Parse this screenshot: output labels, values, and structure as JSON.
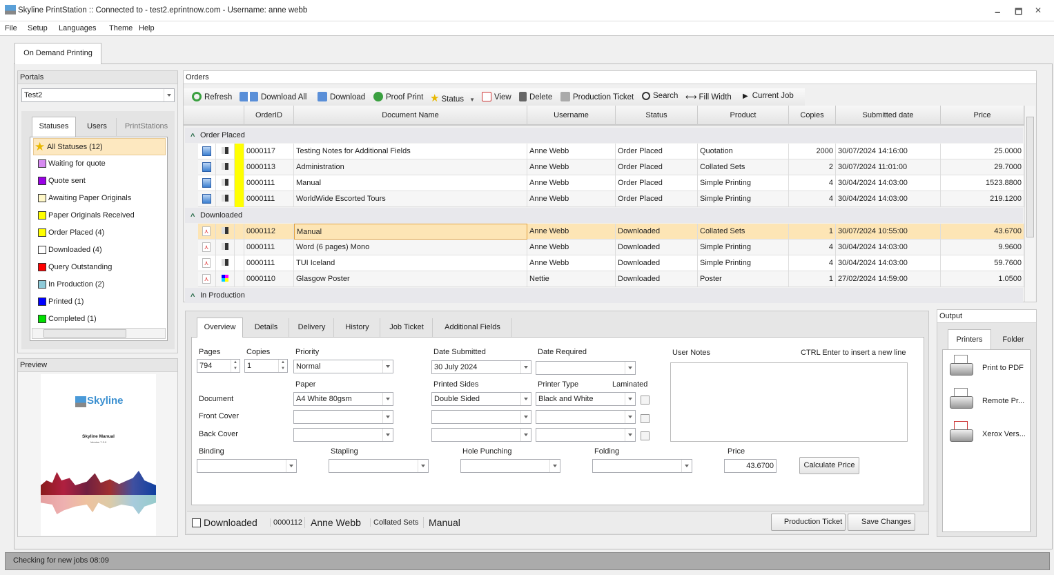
{
  "window": {
    "title": "Skyline PrintStation :: Connected to - test2.eprintnow.com - Username: anne webb",
    "minimize": "🗕",
    "maximize": "🗖",
    "close": "✕"
  },
  "menu": [
    "File",
    "Setup",
    "Languages",
    "Theme",
    "Help"
  ],
  "main_tab": "On Demand Printing",
  "portals": {
    "header": "Portals",
    "selected": "Test2",
    "tabs": [
      "Statuses",
      "Users",
      "PrintStations"
    ],
    "statuses": [
      {
        "label": "All Statuses (12)",
        "color": "star"
      },
      {
        "label": "Waiting for quote",
        "color": "#d68af0"
      },
      {
        "label": "Quote sent",
        "color": "#9a00e6"
      },
      {
        "label": "Awaiting Paper Originals",
        "color": "#fff8c8"
      },
      {
        "label": "Paper Originals Received",
        "color": "#ffff00"
      },
      {
        "label": "Order Placed (4)",
        "color": "#ffff00"
      },
      {
        "label": "Downloaded (4)",
        "color": "#ffffff"
      },
      {
        "label": "Query Outstanding",
        "color": "#ff0000"
      },
      {
        "label": "In Production (2)",
        "color": "#8ecad8"
      },
      {
        "label": "Printed (1)",
        "color": "#0000ff"
      },
      {
        "label": "Completed (1)",
        "color": "#00e000"
      }
    ]
  },
  "preview": {
    "header": "Preview",
    "logo": "Skyline",
    "doc_title": "Skyline Manual",
    "doc_version": "Version 7.3.0"
  },
  "orders": {
    "header": "Orders",
    "toolbar": [
      "Refresh",
      "Download All",
      "Download",
      "Proof Print",
      "Status",
      "View",
      "Delete",
      "Production Ticket",
      "Search",
      "Fill Width",
      "Current Job"
    ],
    "columns": [
      "OrderID",
      "Document Name",
      "Username",
      "Status",
      "Product",
      "Copies",
      "Submitted date",
      "Price"
    ],
    "groups": [
      {
        "name": "Order Placed",
        "rows": [
          [
            "0000117",
            "Testing Notes for Additional Fields",
            "Anne Webb",
            "Order Placed",
            "Quotation",
            "2000",
            "30/07/2024 14:16:00",
            "25.0000"
          ],
          [
            "0000113",
            "Administration",
            "Anne Webb",
            "Order Placed",
            "Collated Sets",
            "2",
            "30/07/2024 11:01:00",
            "29.7000"
          ],
          [
            "0000111",
            "Manual",
            "Anne Webb",
            "Order Placed",
            "Simple Printing",
            "4",
            "30/04/2024 14:03:00",
            "1523.8800"
          ],
          [
            "0000111",
            "WorldWide Escorted Tours",
            "Anne Webb",
            "Order Placed",
            "Simple Printing",
            "4",
            "30/04/2024 14:03:00",
            "219.1200"
          ]
        ]
      },
      {
        "name": "Downloaded",
        "rows": [
          [
            "0000112",
            "Manual",
            "Anne Webb",
            "Downloaded",
            "Collated Sets",
            "1",
            "30/07/2024 10:55:00",
            "43.6700"
          ],
          [
            "0000111",
            "Word (6 pages) Mono",
            "Anne Webb",
            "Downloaded",
            "Simple Printing",
            "4",
            "30/04/2024 14:03:00",
            "9.9600"
          ],
          [
            "0000111",
            "TUI Iceland",
            "Anne Webb",
            "Downloaded",
            "Simple Printing",
            "4",
            "30/04/2024 14:03:00",
            "59.7600"
          ],
          [
            "0000110",
            "Glasgow Poster",
            "Nettie",
            "Downloaded",
            "Poster",
            "1",
            "27/02/2024 14:59:00",
            "1.0500"
          ]
        ]
      },
      {
        "name": "In Production",
        "rows": []
      }
    ],
    "selected_row": "0000112"
  },
  "details": {
    "tabs": [
      "Overview",
      "Details",
      "Delivery",
      "History",
      "Job Ticket",
      "Additional Fields"
    ],
    "labels": {
      "pages": "Pages",
      "copies": "Copies",
      "priority": "Priority",
      "date_submitted": "Date Submitted",
      "date_required": "Date Required",
      "user_notes": "User Notes",
      "notes_hint": "CTRL Enter to insert a new line",
      "paper": "Paper",
      "printed_sides": "Printed Sides",
      "printer_type": "Printer Type",
      "laminated": "Laminated",
      "document": "Document",
      "front_cover": "Front Cover",
      "back_cover": "Back Cover",
      "binding": "Binding",
      "stapling": "Stapling",
      "hole_punching": "Hole Punching",
      "folding": "Folding",
      "price": "Price"
    },
    "values": {
      "pages": "794",
      "copies": "1",
      "priority": "Normal",
      "date_submitted": "30 July 2024",
      "date_required": "",
      "paper": "A4 White 80gsm",
      "printed_sides": "Double Sided",
      "printer_type": "Black and White",
      "price": "43.6700"
    },
    "calculate_price": "Calculate Price",
    "footer": {
      "downloaded": "Downloaded",
      "order_id": "0000112",
      "user": "Anne Webb",
      "product": "Collated Sets",
      "doc": "Manual",
      "production_ticket": "Production Ticket",
      "save_changes": "Save Changes"
    }
  },
  "output": {
    "header": "Output",
    "tabs": [
      "Printers",
      "Folder"
    ],
    "printers": [
      "Print to PDF",
      "Remote Pr...",
      "Xerox Vers..."
    ]
  },
  "status_bar": {
    "text": "Checking for new jobs  08:09"
  }
}
